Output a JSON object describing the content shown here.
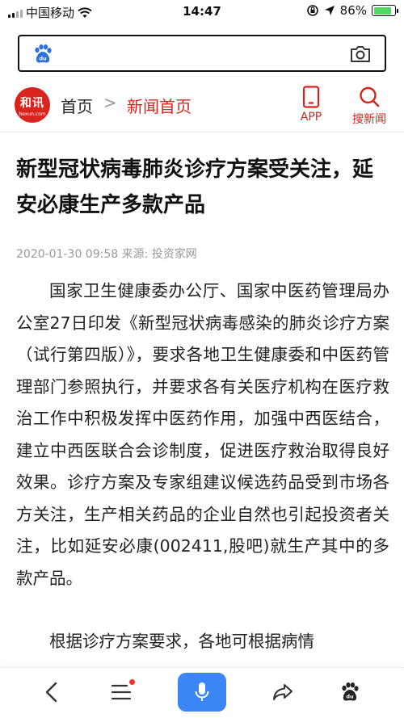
{
  "status_bar": {
    "carrier": "中国移动",
    "time": "14:47",
    "battery_percent": "86%",
    "battery_level": 0.86
  },
  "search": {
    "placeholder": "",
    "icons": {
      "logo": "baidu-paw-icon",
      "camera": "camera-icon"
    }
  },
  "nav": {
    "logo_text": "和讯",
    "logo_subtext": "hexun.com",
    "breadcrumb_home": "首页",
    "breadcrumb_sep": ">",
    "breadcrumb_current": "新闻首页",
    "app_label": "APP",
    "search_label": "搜新闻"
  },
  "article": {
    "title": "新型冠状病毒肺炎诊疗方案受关注，延安必康生产多款产品",
    "date": "2020-01-30 09:58",
    "source": "来源: 投资家网",
    "paragraphs": [
      "国家卫生健康委办公厅、国家中医药管理局办公室27日印发《新型冠状病毒感染的肺炎诊疗方案（试行第四版）》，要求各地卫生健康委和中医药管理部门参照执行，并要求各有关医疗机构在医疗救治工作中积极发挥中医药作用，加强中西医结合，建立中西医联合会诊制度，促进医疗救治取得良好效果。诊疗方案及专家组建议候选药品受到市场各方关注，生产相关药品的企业自然也引起投资者关注，比如延安必康(002411,股吧)就生产其中的多款产品。",
      "根据诊疗方案要求，各地可根据病情"
    ]
  },
  "toolbar": {
    "icons": [
      "back-icon",
      "menu-icon",
      "microphone-icon",
      "share-icon",
      "baidu-paw-icon"
    ],
    "accent_color": "#3a86f2"
  },
  "colors": {
    "brand_red": "#d9231d",
    "meta_gray": "#999999"
  }
}
